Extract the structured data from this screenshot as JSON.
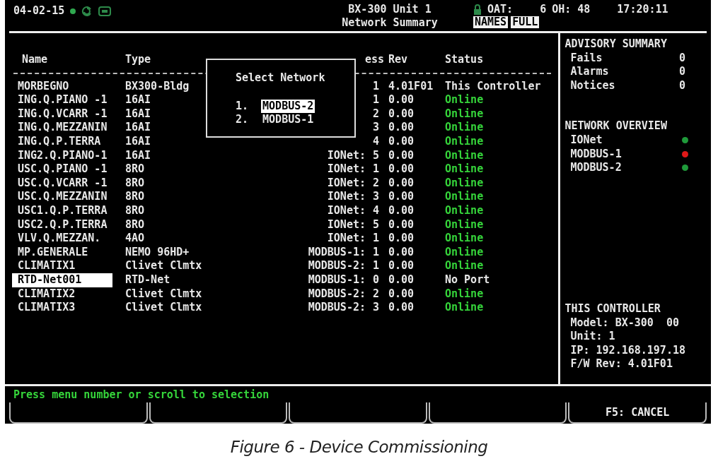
{
  "header": {
    "date": "04-02-15",
    "title": "BX-300 Unit 1",
    "subtitle": "Network Summary",
    "oat_label": "OAT:",
    "oat_value": "6",
    "oh": "OH: 48",
    "time": "17:20:11",
    "view_labels": [
      "NAMES",
      "FULL"
    ]
  },
  "table": {
    "columns": [
      "Name",
      "Type",
      "ess",
      "Rev",
      "Status"
    ],
    "rows": [
      {
        "name": "MORBEGNO",
        "type": "BX300-Bldg",
        "number": "1",
        "rev": "4.01F01",
        "status": "This Controller",
        "kind": "self",
        "selected": false
      },
      {
        "name": "ING.Q.PIANO -1",
        "type": "16AI",
        "number": "1",
        "rev": "0.00",
        "status": "Online",
        "kind": "online",
        "selected": false
      },
      {
        "name": "ING.Q.VCARR -1",
        "type": "16AI",
        "number": "2",
        "rev": "0.00",
        "status": "Online",
        "kind": "online",
        "selected": false
      },
      {
        "name": "ING.Q.MEZZANIN",
        "type": "16AI",
        "number": "3",
        "rev": "0.00",
        "status": "Online",
        "kind": "online",
        "selected": false
      },
      {
        "name": "ING.Q.P.TERRA",
        "type": "16AI",
        "number": "4",
        "rev": "0.00",
        "status": "Online",
        "kind": "online",
        "selected": false
      },
      {
        "name": "ING2.Q.PIANO-1",
        "type": "16AI",
        "address": "IONet:",
        "number": "5",
        "rev": "0.00",
        "status": "Online",
        "kind": "online",
        "selected": false
      },
      {
        "name": "USC.Q.PIANO -1",
        "type": "8RO",
        "address": "IONet:",
        "number": "1",
        "rev": "0.00",
        "status": "Online",
        "kind": "online",
        "selected": false
      },
      {
        "name": "USC.Q.VCARR -1",
        "type": "8RO",
        "address": "IONet:",
        "number": "2",
        "rev": "0.00",
        "status": "Online",
        "kind": "online",
        "selected": false
      },
      {
        "name": "USC.Q.MEZZANIN",
        "type": "8RO",
        "address": "IONet:",
        "number": "3",
        "rev": "0.00",
        "status": "Online",
        "kind": "online",
        "selected": false
      },
      {
        "name": "USC1.Q.P.TERRA",
        "type": "8RO",
        "address": "IONet:",
        "number": "4",
        "rev": "0.00",
        "status": "Online",
        "kind": "online",
        "selected": false
      },
      {
        "name": "USC2.Q.P.TERRA",
        "type": "8RO",
        "address": "IONet:",
        "number": "5",
        "rev": "0.00",
        "status": "Online",
        "kind": "online",
        "selected": false
      },
      {
        "name": "VLV.Q.MEZZAN.",
        "type": "4AO",
        "address": "IONet:",
        "number": "1",
        "rev": "0.00",
        "status": "Online",
        "kind": "online",
        "selected": false
      },
      {
        "name": "MP.GENERALE",
        "type": "NEMO 96HD+",
        "address": "MODBUS-1:",
        "number": "1",
        "rev": "0.00",
        "status": "Online",
        "kind": "online",
        "selected": false
      },
      {
        "name": "CLIMATIX1",
        "type": "Clivet Clmtx",
        "address": "MODBUS-2:",
        "number": "1",
        "rev": "0.00",
        "status": "Online",
        "kind": "online",
        "selected": false
      },
      {
        "name": "RTD-Net001",
        "type": "RTD-Net",
        "address": "MODBUS-1:",
        "number": "0",
        "rev": "0.00",
        "status": "No Port",
        "kind": "noport",
        "selected": true
      },
      {
        "name": "CLIMATIX2",
        "type": "Clivet Clmtx",
        "address": "MODBUS-2:",
        "number": "2",
        "rev": "0.00",
        "status": "Online",
        "kind": "online",
        "selected": false
      },
      {
        "name": "CLIMATIX3",
        "type": "Clivet Clmtx",
        "address": "MODBUS-2:",
        "number": "3",
        "rev": "0.00",
        "status": "Online",
        "kind": "online",
        "selected": false
      }
    ]
  },
  "dialog": {
    "title": "Select Network",
    "options": [
      {
        "number": "1.",
        "label": "MODBUS-2",
        "selected": true
      },
      {
        "number": "2.",
        "label": "MODBUS-1",
        "selected": false
      }
    ]
  },
  "advisory": {
    "title": "ADVISORY SUMMARY",
    "items": [
      {
        "label": "Fails",
        "value": "0"
      },
      {
        "label": "Alarms",
        "value": "0"
      },
      {
        "label": "Notices",
        "value": "0"
      }
    ]
  },
  "network_overview": {
    "title": "NETWORK OVERVIEW",
    "items": [
      {
        "label": "IONet",
        "color": "#1f9a3a"
      },
      {
        "label": "MODBUS-1",
        "color": "#e01818"
      },
      {
        "label": "MODBUS-2",
        "color": "#1f9a3a"
      }
    ]
  },
  "controller": {
    "title": "THIS CONTROLLER",
    "lines": [
      "Model: BX-300  00",
      "Unit: 1",
      "IP: 192.168.197.18",
      "F/W Rev: 4.01F01"
    ]
  },
  "message": "Press menu number or scroll to selection",
  "soft_keys": [
    {
      "kind": "blank"
    },
    {
      "kind": "blank"
    },
    {
      "kind": "blank"
    },
    {
      "kind": "blank"
    },
    {
      "kind": "labeled",
      "label": "F5: CANCEL"
    }
  ],
  "caption": "Figure 6 - Device Commissioning"
}
